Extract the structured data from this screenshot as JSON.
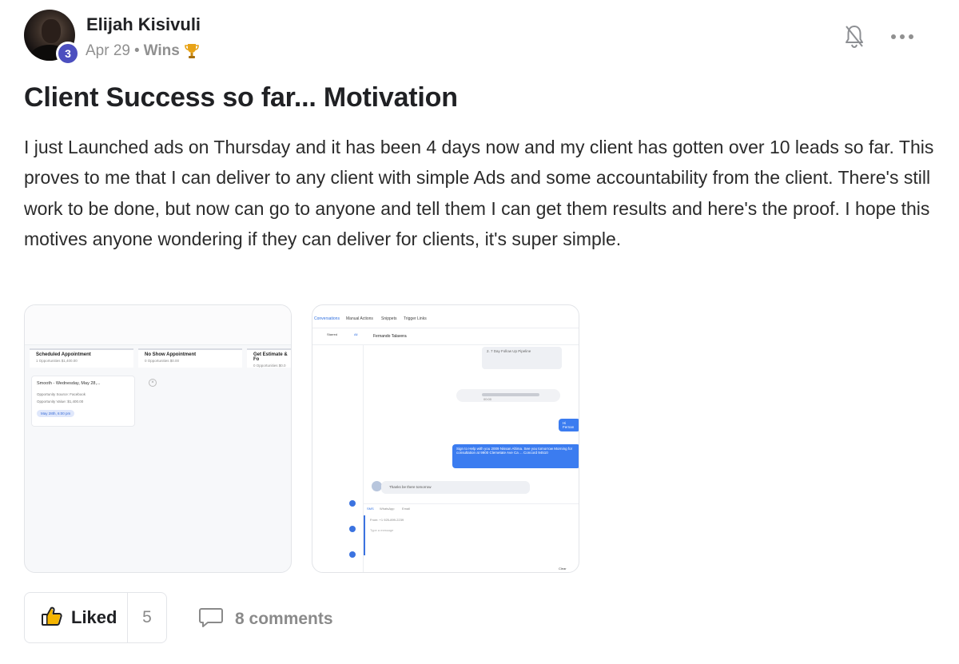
{
  "author": {
    "name": "Elijah Kisivuli",
    "level": "3"
  },
  "meta": {
    "date": "Apr 29",
    "separator": "•",
    "category": "Wins"
  },
  "post": {
    "title": "Client Success so far... Motivation",
    "body": "I just Launched ads on Thursday and it has been 4 days now and my client has gotten over 10 leads so far. This proves to me that I can deliver to any client with simple Ads and some accountability from the client. There's still work to be done, but now can go to anyone and tell them I can get them results and here's the proof. I hope this motives anyone wondering if they can deliver for clients, it's super simple."
  },
  "attachment_1": {
    "columns": [
      {
        "title": "Scheduled Appointment",
        "sub": "1 Opportunities  $1,400.00"
      },
      {
        "title": "No Show Appointment",
        "sub": "0 Opportunities  $0.00"
      },
      {
        "title": "Get Estimate & Fo",
        "sub": "0 Opportunities  $0.0"
      }
    ],
    "card_title": "Smooth - Wednesday, May 28,...",
    "card_source": "Opportunity Source:  Facebook",
    "card_value": "Opportunity Value:  $1,400.00",
    "card_chip": "May 28th, 6:00 pm"
  },
  "attachment_2": {
    "tabs": [
      "Conversations",
      "Manual Actions",
      "Snippets",
      "Trigger Links"
    ],
    "contact": "Fernando Talavera",
    "subtabs": [
      "Starred",
      "All"
    ],
    "workflow": "2. 7 Day Follow Up Pipeline",
    "outgoing_1": "Hi Fernan",
    "outgoing_2": "Sign to Help with you 2009 Nissan Altima. See you tomorrow Morning for consultation at 9900 Clemetate Ave Ca ... Concord 94510",
    "incoming": "Thanks be there tomorrow",
    "channels": [
      "SMS",
      "WhatsApp",
      "Email"
    ],
    "from_line": "From:  +1 925-899-2239",
    "placeholder": "Type a message",
    "clear": "Clear",
    "audio_time": "00:00"
  },
  "actions": {
    "like_label": "Liked",
    "like_count": "5",
    "comments_label": "8 comments"
  },
  "colors": {
    "level_badge": "#4c4fbf",
    "text_primary": "#202124",
    "text_muted": "#909090",
    "chat_blue": "#3b7cf0"
  }
}
